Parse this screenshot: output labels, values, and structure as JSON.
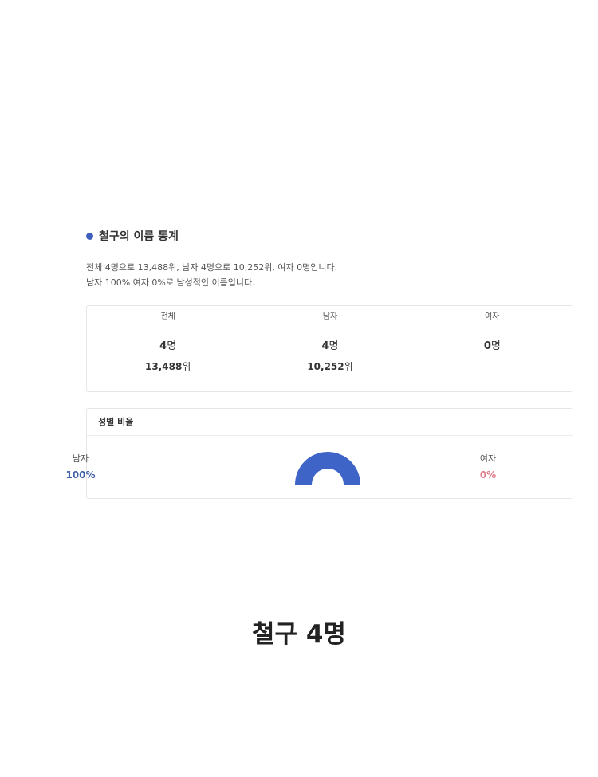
{
  "section": {
    "title": "철구의 이름 통계"
  },
  "summary": {
    "line1": "전체 4명으로 13,488위, 남자 4명으로 10,252위, 여자 0명입니다.",
    "line2": "남자 100% 여자 0%로 남성적인 이름입니다."
  },
  "stats": {
    "headers": {
      "total": "전체",
      "male": "남자",
      "female": "여자"
    },
    "counts": {
      "total": "4",
      "male": "4",
      "female": "0",
      "unit": "명"
    },
    "ranks": {
      "total": "13,488",
      "male": "10,252",
      "unit": "위"
    }
  },
  "ratio": {
    "title": "성별 비율",
    "male_label": "남자",
    "male_pct": "100%",
    "female_label": "여자",
    "female_pct": "0%",
    "male_fraction": 1.0,
    "male_color": "#3f64c8",
    "female_color": "#e07c8a"
  },
  "caption": "철구 4명"
}
